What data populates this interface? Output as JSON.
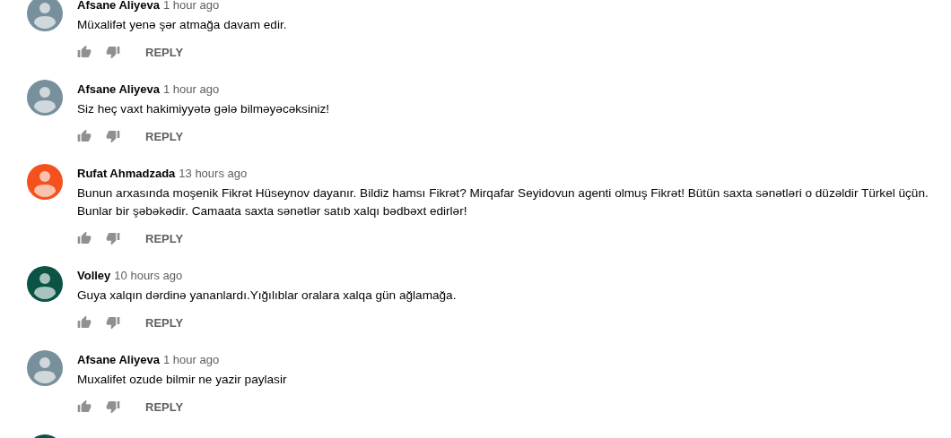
{
  "comments": [
    {
      "author": "Afsane Aliyeva",
      "time": "1 hour ago",
      "text": "Müxalifət yenə şər atmağa davam edir.",
      "color": "#78909c",
      "reply": "REPLY"
    },
    {
      "author": "Afsane Aliyeva",
      "time": "1 hour ago",
      "text": "Siz heç vaxt hakimiyyətə gələ bilməyəcəksiniz!",
      "color": "#78909c",
      "reply": "REPLY"
    },
    {
      "author": "Rufat Ahmadzada",
      "time": "13 hours ago",
      "text": "Bunun arxasında moşenik Fikrət Hüseynov dayanır. Bildiz hamsı Fikrət? Mirqafar Seyidovun agenti olmuş Fikrət! Bütün saxta sənətləri o düzəldir Türkel üçün. Bunlar bir şəbəkədir. Camaata saxta sənətlər satıb xalqı bədbəxt edirlər!",
      "color": "#f4511e",
      "reply": "REPLY"
    },
    {
      "author": "Volley",
      "time": "10 hours ago",
      "text": "Guya xalqın dərdinə yananlardı.Yığılıblar oralara xalqa gün ağlamağa.",
      "color": "#0b5345",
      "reply": "REPLY"
    },
    {
      "author": "Afsane Aliyeva",
      "time": "1 hour ago",
      "text": "Muxalifet ozude bilmir ne yazir paylasir",
      "color": "#78909c",
      "reply": "REPLY"
    }
  ],
  "next_comment": {
    "color": "#0b5345"
  }
}
